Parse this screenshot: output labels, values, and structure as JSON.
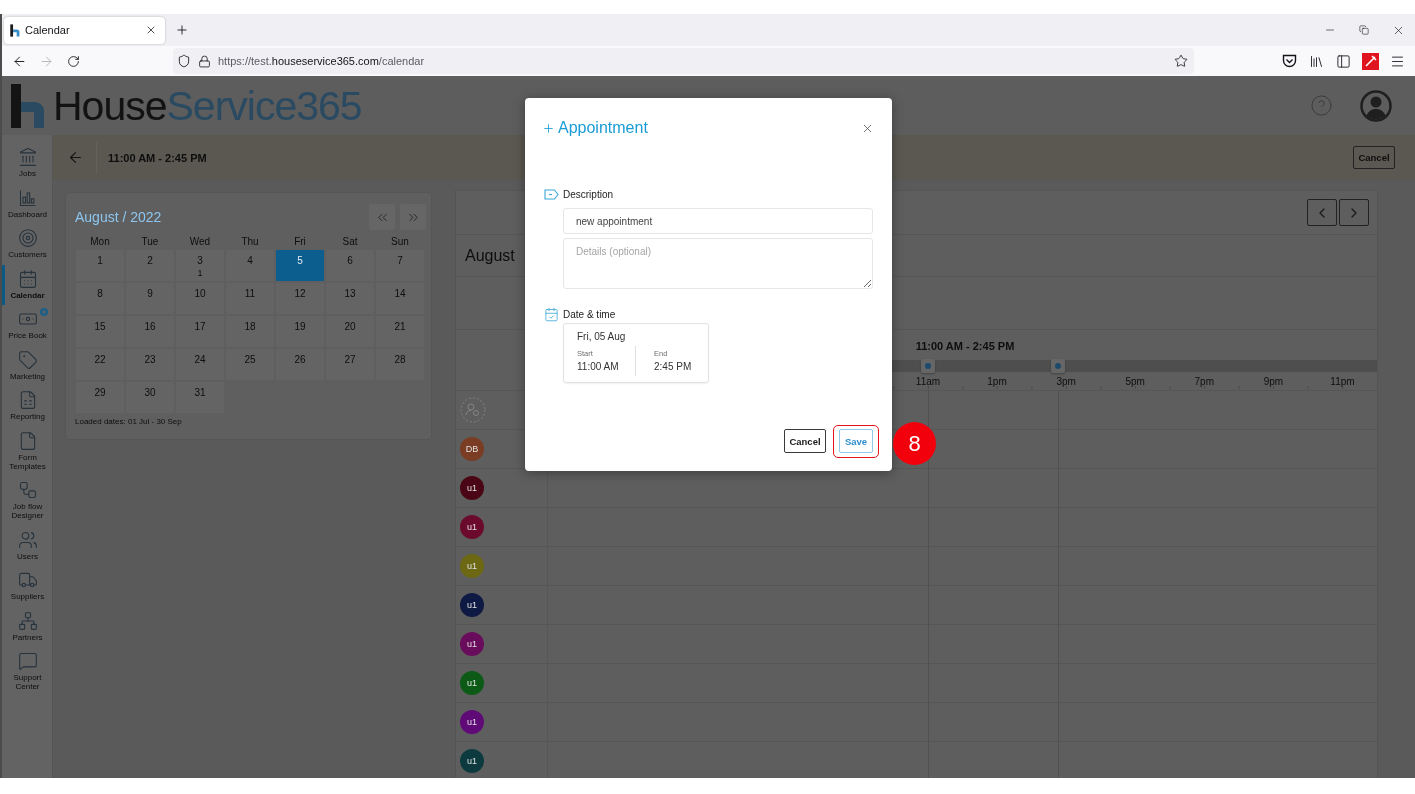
{
  "browser": {
    "tab": {
      "title": "Calendar"
    },
    "forward_disabled": true,
    "url": {
      "prefix": "https://test.",
      "domain": "houseservice365.com",
      "path": "/calendar"
    }
  },
  "header": {
    "brand": {
      "first": "House",
      "second": "Service365"
    }
  },
  "toolbar": {
    "range": "11:00 AM - 2:45 PM",
    "cancel": "Cancel"
  },
  "sidebar": {
    "items": [
      {
        "label": "Jobs",
        "selected": false,
        "badge": false
      },
      {
        "label": "Dashboard",
        "selected": false,
        "badge": false
      },
      {
        "label": "Customers",
        "selected": false,
        "badge": false
      },
      {
        "label": "Calendar",
        "selected": true,
        "badge": false
      },
      {
        "label": "Price Book",
        "selected": false,
        "badge": true
      },
      {
        "label": "Marketing",
        "selected": false,
        "badge": false
      },
      {
        "label": "Reporting",
        "selected": false,
        "badge": false
      },
      {
        "label": "Form Templates",
        "selected": false,
        "badge": false
      },
      {
        "label": "Job flow Designer",
        "selected": false,
        "badge": false
      },
      {
        "label": "Users",
        "selected": false,
        "badge": false
      },
      {
        "label": "Suppliers",
        "selected": false,
        "badge": false
      },
      {
        "label": "Partners",
        "selected": false,
        "badge": false
      },
      {
        "label": "Support Center",
        "selected": false,
        "badge": false
      }
    ]
  },
  "mini_calendar": {
    "title": "August / 2022",
    "weekdays": [
      "Mon",
      "Tue",
      "Wed",
      "Thu",
      "Fri",
      "Sat",
      "Sun"
    ],
    "days": [
      {
        "day": "1",
        "selected": false
      },
      {
        "day": "2",
        "selected": false
      },
      {
        "day": "3",
        "count": "1",
        "selected": false
      },
      {
        "day": "4",
        "selected": false
      },
      {
        "day": "5",
        "selected": true
      },
      {
        "day": "6",
        "selected": false
      },
      {
        "day": "7",
        "selected": false
      },
      {
        "day": "8",
        "selected": false
      },
      {
        "day": "9",
        "selected": false
      },
      {
        "day": "10",
        "selected": false
      },
      {
        "day": "11",
        "selected": false
      },
      {
        "day": "12",
        "selected": false
      },
      {
        "day": "13",
        "selected": false
      },
      {
        "day": "14",
        "selected": false
      },
      {
        "day": "15",
        "selected": false
      },
      {
        "day": "16",
        "selected": false
      },
      {
        "day": "17",
        "selected": false
      },
      {
        "day": "18",
        "selected": false
      },
      {
        "day": "19",
        "selected": false
      },
      {
        "day": "20",
        "selected": false
      },
      {
        "day": "21",
        "selected": false
      },
      {
        "day": "22",
        "selected": false
      },
      {
        "day": "23",
        "selected": false
      },
      {
        "day": "24",
        "selected": false
      },
      {
        "day": "25",
        "selected": false
      },
      {
        "day": "26",
        "selected": false
      },
      {
        "day": "27",
        "selected": false
      },
      {
        "day": "28",
        "selected": false
      },
      {
        "day": "29",
        "selected": false
      },
      {
        "day": "30",
        "selected": false
      },
      {
        "day": "31",
        "selected": false
      }
    ],
    "footer": "Loaded dates: 01 Jul - 30 Sep"
  },
  "schedule": {
    "month": "August",
    "timeline": {
      "range": "11:00 AM - 2:45 PM",
      "handles": [
        {
          "level": 0.458
        },
        {
          "level": 0.615
        }
      ],
      "hours": [
        "11am",
        "1pm",
        "3pm",
        "5pm",
        "7pm",
        "9pm",
        "11pm"
      ]
    },
    "resources": [
      {
        "kind": "unassigned"
      },
      {
        "kind": "user",
        "initials": "DB",
        "color": "#7a3c22"
      },
      {
        "kind": "user",
        "initials": "u1",
        "color": "#4a0614"
      },
      {
        "kind": "user",
        "initials": "u1",
        "color": "#6b0a2c"
      },
      {
        "kind": "user",
        "initials": "u1",
        "color": "#6c6814"
      },
      {
        "kind": "user",
        "initials": "u1",
        "color": "#0e1a44"
      },
      {
        "kind": "user",
        "initials": "u1",
        "color": "#6a0c5c"
      },
      {
        "kind": "user",
        "initials": "u1",
        "color": "#0c5a16"
      },
      {
        "kind": "user",
        "initials": "u1",
        "color": "#600a78"
      },
      {
        "kind": "user",
        "initials": "u1",
        "color": "#0c3a3e"
      }
    ]
  },
  "dialog": {
    "title": "Appointment",
    "description": {
      "label": "Description",
      "value": "new appointment",
      "details": {
        "placeholder": "Details (optional)"
      }
    },
    "date_time": {
      "label": "Date & time",
      "date": "Fri, 05 Aug",
      "start_label": "Start",
      "start": "11:00 AM",
      "end_label": "End",
      "end": "2:45 PM"
    },
    "buttons": [
      {
        "label": "Cancel",
        "kind": "secondary",
        "highlighted": false
      },
      {
        "label": "Save",
        "kind": "primary",
        "highlighted": true
      }
    ]
  },
  "step_marker": {
    "label": "8"
  }
}
